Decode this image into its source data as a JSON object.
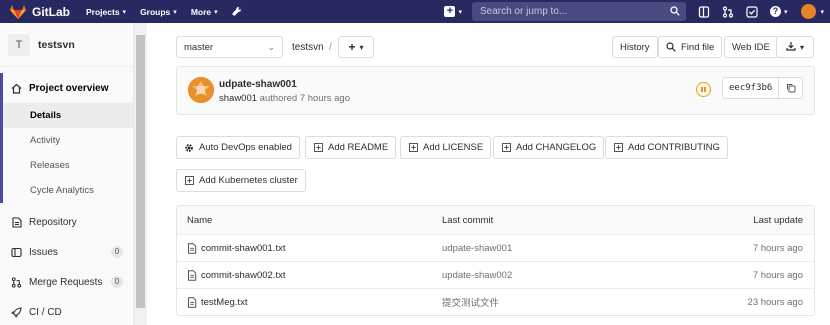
{
  "navbar": {
    "brand": "GitLab",
    "menu": [
      {
        "label": "Projects"
      },
      {
        "label": "Groups"
      },
      {
        "label": "More"
      }
    ],
    "search_placeholder": "Search or jump to...",
    "help": "?"
  },
  "sidebar": {
    "project_initial": "T",
    "project_name": "testsvn",
    "overview": "Project overview",
    "sub": [
      "Details",
      "Activity",
      "Releases",
      "Cycle Analytics"
    ],
    "items": [
      {
        "label": "Repository"
      },
      {
        "label": "Issues",
        "count": "0"
      },
      {
        "label": "Merge Requests",
        "count": "0"
      },
      {
        "label": "CI / CD"
      }
    ]
  },
  "toolbar": {
    "branch": "master",
    "path_root": "testsvn",
    "path_sep": "/",
    "history": "History",
    "find_file": "Find file",
    "web_ide": "Web IDE"
  },
  "commit": {
    "title": "udpate-shaw001",
    "author": "shaw001",
    "authored": "authored 7 hours ago",
    "sha": "eec9f3b6"
  },
  "actions": {
    "auto_devops": "Auto DevOps enabled",
    "add_readme": "Add README",
    "add_license": "Add LICENSE",
    "add_changelog": "Add CHANGELOG",
    "add_contributing": "Add CONTRIBUTING",
    "add_kubernetes": "Add Kubernetes cluster"
  },
  "files": {
    "headers": [
      "Name",
      "Last commit",
      "Last update"
    ],
    "rows": [
      {
        "name": "commit-shaw001.txt",
        "commit": "udpate-shaw001",
        "updated": "7 hours ago"
      },
      {
        "name": "commit-shaw002.txt",
        "commit": "update-shaw002",
        "updated": "7 hours ago"
      },
      {
        "name": "testMeg.txt",
        "commit": "提交测试文件",
        "updated": "23 hours ago"
      }
    ]
  },
  "colors": {
    "navbar": "#292961",
    "accent": "#4b4ba3",
    "pipeline_pending": "#fc9403"
  }
}
